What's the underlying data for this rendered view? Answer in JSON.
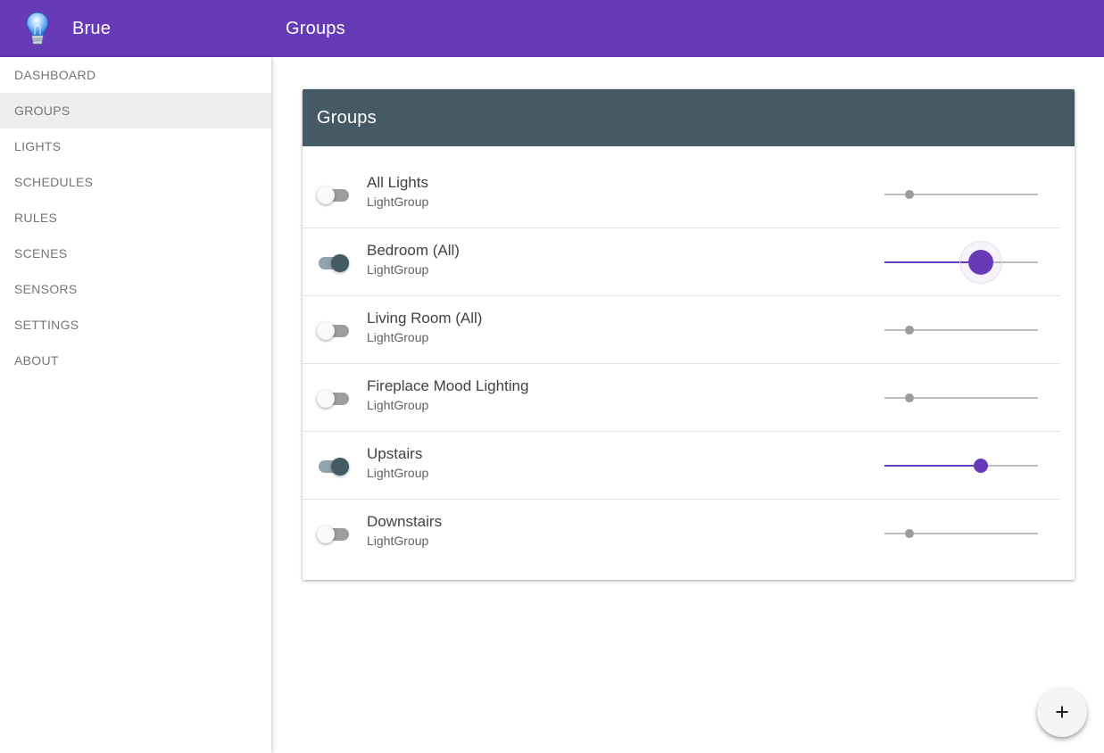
{
  "app": {
    "name": "Brue",
    "logo_icon": "lightbulb-icon"
  },
  "header": {
    "page_title": "Groups"
  },
  "sidebar": {
    "items": [
      {
        "label": "DASHBOARD",
        "active": false
      },
      {
        "label": "GROUPS",
        "active": true
      },
      {
        "label": "LIGHTS",
        "active": false
      },
      {
        "label": "SCHEDULES",
        "active": false
      },
      {
        "label": "RULES",
        "active": false
      },
      {
        "label": "SCENES",
        "active": false
      },
      {
        "label": "SENSORS",
        "active": false
      },
      {
        "label": "SETTINGS",
        "active": false
      },
      {
        "label": "ABOUT",
        "active": false
      }
    ]
  },
  "card": {
    "title": "Groups",
    "groups": [
      {
        "name": "All Lights",
        "type": "LightGroup",
        "on": false,
        "brightness": 0.16,
        "focused": false
      },
      {
        "name": "Bedroom (All)",
        "type": "LightGroup",
        "on": true,
        "brightness": 0.63,
        "focused": true
      },
      {
        "name": "Living Room (All)",
        "type": "LightGroup",
        "on": false,
        "brightness": 0.16,
        "focused": false
      },
      {
        "name": "Fireplace Mood Lighting",
        "type": "LightGroup",
        "on": false,
        "brightness": 0.16,
        "focused": false
      },
      {
        "name": "Upstairs",
        "type": "LightGroup",
        "on": true,
        "brightness": 0.63,
        "focused": false
      },
      {
        "name": "Downstairs",
        "type": "LightGroup",
        "on": false,
        "brightness": 0.16,
        "focused": false
      }
    ]
  },
  "fab": {
    "icon": "plus-icon"
  },
  "colors": {
    "primary": "#673ab7",
    "card_header": "#455a64",
    "toggle_on_thumb": "#455a64",
    "toggle_on_track": "#90a4ae",
    "inactive": "#9e9e9e"
  }
}
